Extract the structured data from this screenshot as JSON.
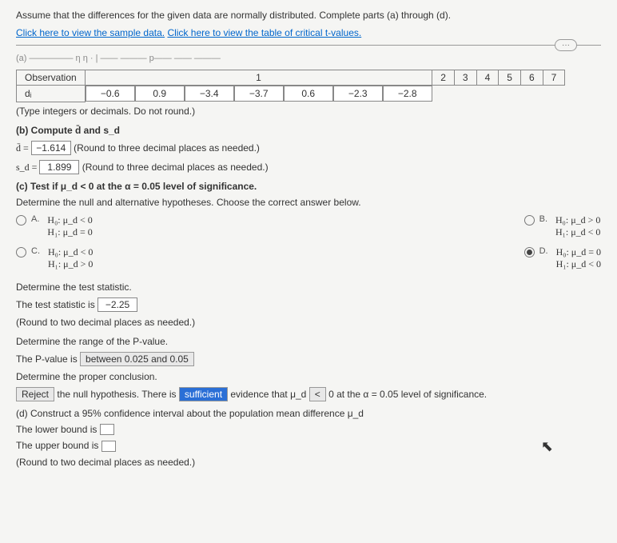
{
  "instr": "Assume that the differences for the given data are normally distributed. Complete parts (a) through (d).",
  "link1": "Click here to view the sample data.",
  "link2": "Click here to view the table of critical t-values.",
  "pager": "···",
  "faded_line": "(a) —————  η   η   ·  | —— ——— p—— —— ———",
  "table": {
    "h0": "Observation",
    "h1": "1",
    "h2": "2",
    "h3": "3",
    "h4": "4",
    "h5": "5",
    "h6": "6",
    "h7": "7",
    "r0": "dᵢ",
    "r1": "−0.6",
    "r2": "0.9",
    "r3": "−3.4",
    "r4": "−3.7",
    "r5": "0.6",
    "r6": "−2.3",
    "r7": "−2.8"
  },
  "hint_table": "(Type integers or decimals. Do not round.)",
  "part_b": "(b) Compute d̄ and s_d",
  "dbar_lbl": "d̄ = ",
  "dbar_val": "−1.614",
  "dbar_tail": " (Round to three decimal places as needed.)",
  "sd_lbl": "s_d = ",
  "sd_val": "1.899",
  "sd_tail": " (Round to three decimal places as needed.)",
  "part_c": "(c) Test if μ_d < 0 at the α = 0.05 level of significance.",
  "det_hyp": "Determine the null and alternative hypotheses. Choose the correct answer below.",
  "optA_tag": "A.",
  "optA1": "H₀: μ_d < 0",
  "optA2": "H₁: μ_d = 0",
  "optB_tag": "B.",
  "optB1": "H₀: μ_d > 0",
  "optB2": "H₁: μ_d < 0",
  "optC_tag": "C.",
  "optC1": "H₀: μ_d < 0",
  "optC2": "H₁: μ_d > 0",
  "optD_tag": "D.",
  "optD1": "H₀: μ_d = 0",
  "optD2": "H₁: μ_d < 0",
  "det_ts": "Determine the test statistic.",
  "ts_line_a": "The test statistic is ",
  "ts_val": "−2.25",
  "ts_tail": "(Round to two decimal places as needed.)",
  "det_p": "Determine the range of the P-value.",
  "p_a": "The P-value is ",
  "p_b": "between 0.025 and 0.05",
  "det_conc": "Determine the proper conclusion.",
  "conc_a": "Reject",
  "conc_b": " the null hypothesis. There is ",
  "conc_c": "sufficient",
  "conc_d": " evidence that μ_d ",
  "conc_e": "<",
  "conc_f": " 0 at the α = 0.05 level of significance.",
  "part_d": "(d) Construct a 95% confidence interval about the population mean difference μ_d",
  "lb": "The lower bound is ",
  "ub": "The upper bound is ",
  "ci_tail": "(Round to two decimal places as needed.)"
}
